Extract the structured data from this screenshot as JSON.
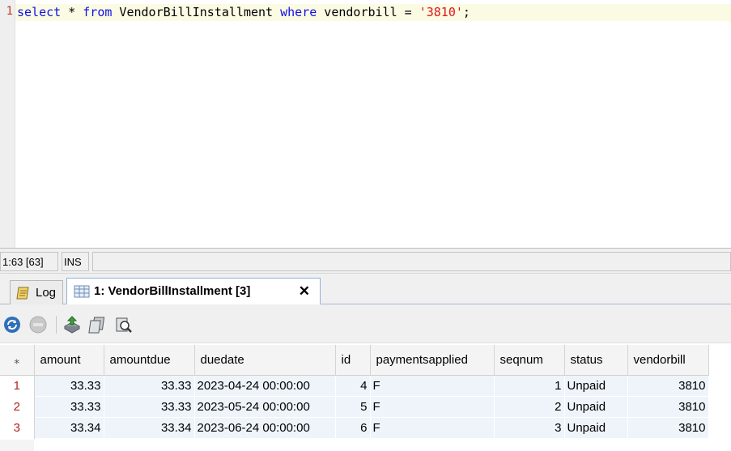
{
  "editor": {
    "line_number": "1",
    "sql": {
      "kw_select": "select",
      "star": " * ",
      "kw_from": "from",
      "table": " VendorBillInstallment ",
      "kw_where": "where",
      "condition": " vendorbill = ",
      "literal": "'3810'",
      "terminator": ";"
    }
  },
  "status": {
    "position": "1:63 [63]",
    "mode": "INS"
  },
  "tabs": [
    {
      "label": "Log",
      "icon": "log-icon"
    },
    {
      "label": "1: VendorBillInstallment [3]",
      "icon": "table-grid-icon",
      "close": "✕"
    }
  ],
  "toolbar": {
    "buttons": [
      "refresh-icon",
      "stop-icon",
      "export-icon",
      "copy-icon",
      "inspect-icon"
    ]
  },
  "grid": {
    "corner": "⁎",
    "columns": [
      "amount",
      "amountdue",
      "duedate",
      "id",
      "paymentsapplied",
      "seqnum",
      "status",
      "vendorbill"
    ],
    "rows": [
      {
        "n": "1",
        "amount": "33.33",
        "amountdue": "33.33",
        "duedate": "2023-04-24 00:00:00",
        "id": "4",
        "paymentsapplied": "F",
        "seqnum": "1",
        "status": "Unpaid",
        "vendorbill": "3810"
      },
      {
        "n": "2",
        "amount": "33.33",
        "amountdue": "33.33",
        "duedate": "2023-05-24 00:00:00",
        "id": "5",
        "paymentsapplied": "F",
        "seqnum": "2",
        "status": "Unpaid",
        "vendorbill": "3810"
      },
      {
        "n": "3",
        "amount": "33.34",
        "amountdue": "33.34",
        "duedate": "2023-06-24 00:00:00",
        "id": "6",
        "paymentsapplied": "F",
        "seqnum": "3",
        "status": "Unpaid",
        "vendorbill": "3810"
      }
    ]
  },
  "colors": {
    "keyword": "#1010e8",
    "string_literal": "#e01515",
    "row_number": "#b22222",
    "cell_background": "#eef4fa"
  }
}
